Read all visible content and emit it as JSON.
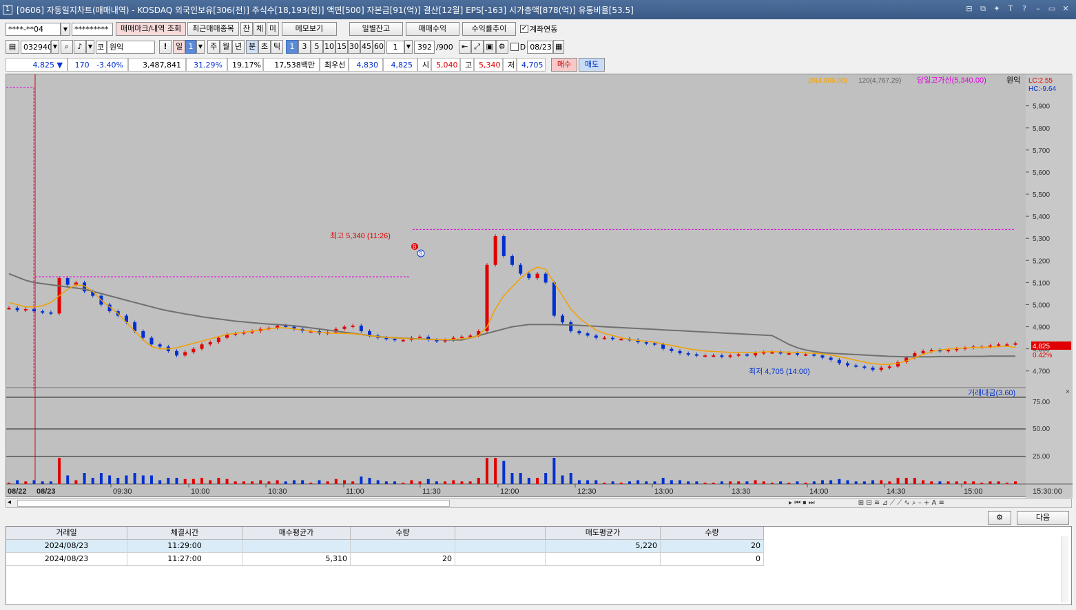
{
  "window": {
    "title": "[0606] 자동일지차트(매매내역) - KOSDAQ 외국인보유[306(천)] 주식수[18,193(천)] 액면[500] 자본금[91(억)] 결산[12월] EPS[-163] 시가총액[878(억)] 유통비율[53.5]",
    "icon_label": "1",
    "buttons": [
      "⊟",
      "⧉",
      "✦",
      "T",
      "?",
      "–",
      "▭",
      "✕"
    ]
  },
  "toolbar1": {
    "account": "****-**04",
    "password": "*********",
    "btn_mark": "매매마크/내역 조회",
    "btn_recent": "최근매매종목",
    "btn_jan": "잔",
    "btn_che": "체",
    "btn_mi": "미",
    "btn_memo": "메모보기",
    "btn_daily": "일별잔고",
    "btn_profit": "매매수익",
    "btn_rate": "수익률추이",
    "chk_label": "계좌연동",
    "chk_mark": "✓"
  },
  "toolbar2": {
    "code": "032940",
    "market": "코",
    "name": "원익",
    "excl": "!",
    "day": "일",
    "day_n": "1",
    "periods": [
      "주",
      "월",
      "년",
      "분",
      "초",
      "틱"
    ],
    "minutes": [
      "1",
      "3",
      "5",
      "10",
      "15",
      "30",
      "45",
      "60"
    ],
    "unit": "1",
    "count": "392",
    "count_max": "/900",
    "d_label": "D",
    "date": "08/23"
  },
  "quote": {
    "price": "4,825",
    "arrow": "▼",
    "change": "170",
    "rate": "-3.40%",
    "volume": "3,487,841",
    "ratio1": "31.29%",
    "ratio2": "19.17%",
    "amount": "17,538백만",
    "best_label": "최우선",
    "best_sell": "4,830",
    "best_buy": "4,825",
    "open_label": "시",
    "open": "5,040",
    "high_label": "고",
    "high": "5,340",
    "low_label": "저",
    "low": "4,705",
    "buy_btn": "매수",
    "sell_btn": "매도"
  },
  "chart_legend": {
    "ma20": "20(4,806.00)",
    "ma120": "120(4,767.29)",
    "high_line": "당일고가선(5,340.00)",
    "stock_name": "원익",
    "lc": "LC:2.55",
    "hc": "HC:-9.64",
    "high_annot": "최고 5,340 (11:26)",
    "low_annot": "최저 4,705 (14:00)",
    "current_price": "4,825",
    "current_rate": "0.42%",
    "buy_marker": "B",
    "sell_marker": "S",
    "volume_legend": "거래대금(3.60)",
    "close_box": "×"
  },
  "colors": {
    "up": "#e00000",
    "down": "#0030d0",
    "ma20": "#f2a000",
    "ma120": "#707070",
    "high_line": "#e000e0",
    "chart_bg": "#c0c0c0"
  },
  "chart_data": {
    "type": "candlestick",
    "price_axis": [
      "5,900",
      "5,800",
      "5,700",
      "5,600",
      "5,500",
      "5,400",
      "5,300",
      "5,200",
      "5,100",
      "5,000",
      "4,900",
      "4,800",
      "4,700"
    ],
    "price_ticks": [
      5900,
      5800,
      5700,
      5600,
      5500,
      5400,
      5300,
      5200,
      5100,
      5000,
      4900,
      4800,
      4700
    ],
    "ylim": [
      4640,
      5980
    ],
    "volume_axis": [
      "75.00",
      "50.00",
      "25.00"
    ],
    "time_axis": [
      "08/22",
      "08/23",
      "09:30",
      "10:00",
      "10:30",
      "11:00",
      "11:30",
      "12:00",
      "12:30",
      "13:00",
      "13:30",
      "14:00",
      "14:30",
      "15:00",
      "15:30:00"
    ],
    "day_high": 5340,
    "day_low": 4705,
    "current": 4825,
    "price_series_close": [
      4985,
      4975,
      4980,
      4970,
      4965,
      4960,
      5120,
      5090,
      5100,
      5060,
      5040,
      5000,
      4970,
      4950,
      4920,
      4880,
      4850,
      4820,
      4810,
      4790,
      4770,
      4785,
      4800,
      4820,
      4830,
      4850,
      4865,
      4870,
      4875,
      4880,
      4890,
      4895,
      4905,
      4900,
      4890,
      4880,
      4880,
      4870,
      4875,
      4890,
      4900,
      4905,
      4880,
      4860,
      4850,
      4845,
      4840,
      4840,
      4850,
      4855,
      4840,
      4835,
      4840,
      4850,
      4855,
      4860,
      4880,
      5180,
      5310,
      5220,
      5180,
      5140,
      5120,
      5140,
      5100,
      4950,
      4920,
      4880,
      4870,
      4860,
      4850,
      4850,
      4845,
      4845,
      4840,
      4830,
      4825,
      4820,
      4800,
      4790,
      4780,
      4775,
      4770,
      4770,
      4770,
      4765,
      4770,
      4775,
      4770,
      4780,
      4785,
      4785,
      4780,
      4780,
      4775,
      4775,
      4770,
      4760,
      4750,
      4735,
      4725,
      4720,
      4715,
      4705,
      4715,
      4720,
      4740,
      4760,
      4780,
      4790,
      4795,
      4790,
      4795,
      4800,
      4805,
      4810,
      4810,
      4815,
      4820,
      4820,
      4825
    ],
    "ma20_series": [
      5010,
      5000,
      4990,
      4990,
      4995,
      5010,
      5040,
      5070,
      5090,
      5085,
      5060,
      5020,
      4990,
      4960,
      4920,
      4880,
      4840,
      4810,
      4800,
      4800,
      4805,
      4815,
      4825,
      4835,
      4845,
      4855,
      4865,
      4870,
      4875,
      4880,
      4885,
      4890,
      4895,
      4895,
      4890,
      4885,
      4880,
      4875,
      4872,
      4870,
      4870,
      4868,
      4865,
      4860,
      4855,
      4852,
      4850,
      4848,
      4845,
      4845,
      4843,
      4842,
      4842,
      4843,
      4845,
      4850,
      4860,
      4900,
      4980,
      5040,
      5080,
      5120,
      5150,
      5170,
      5160,
      5100,
      5040,
      4980,
      4940,
      4910,
      4885,
      4870,
      4860,
      4850,
      4843,
      4838,
      4834,
      4830,
      4822,
      4815,
      4808,
      4800,
      4795,
      4790,
      4788,
      4786,
      4784,
      4783,
      4783,
      4784,
      4786,
      4787,
      4786,
      4785,
      4783,
      4782,
      4780,
      4777,
      4772,
      4765,
      4757,
      4748,
      4740,
      4733,
      4730,
      4730,
      4735,
      4745,
      4760,
      4775,
      4787,
      4795,
      4799,
      4802,
      4804,
      4806,
      4807,
      4808,
      4810,
      4812,
      4806
    ],
    "ma120_series": [
      5140,
      5125,
      5110,
      5100,
      5095,
      5090,
      5085,
      5080,
      5075,
      5070,
      5060,
      5050,
      5040,
      5030,
      5020,
      5010,
      5000,
      4990,
      4980,
      4972,
      4965,
      4958,
      4952,
      4945,
      4940,
      4935,
      4930,
      4925,
      4922,
      4918,
      4915,
      4912,
      4910,
      4907,
      4904,
      4900,
      4895,
      4890,
      4885,
      4880,
      4875,
      4870,
      4865,
      4860,
      4855,
      4852,
      4850,
      4848,
      4846,
      4845,
      4843,
      4842,
      4841,
      4840,
      4840,
      4850,
      4860,
      4870,
      4880,
      4890,
      4900,
      4905,
      4910,
      4910,
      4910,
      4910,
      4909,
      4908,
      4906,
      4904,
      4902,
      4900,
      4898,
      4896,
      4894,
      4892,
      4890,
      4888,
      4886,
      4884,
      4882,
      4880,
      4878,
      4876,
      4874,
      4872,
      4870,
      4868,
      4866,
      4864,
      4862,
      4860,
      4840,
      4820,
      4805,
      4795,
      4788,
      4783,
      4780,
      4778,
      4776,
      4774,
      4772,
      4770,
      4768,
      4766,
      4765,
      4764,
      4764,
      4764,
      4764,
      4765,
      4765,
      4765,
      4766,
      4766,
      4766,
      4767,
      4767,
      4767,
      4767
    ]
  },
  "nav": {
    "left_arrow": "◂",
    "right_arrow": "▸",
    "btn_prev": "⏮",
    "btn_stop": "⏹",
    "btn_next": "⏭",
    "tool_icons": "⊞ ⊟ ≋ ⊿ ⟋ ⟋ ∿ ⌕ – + A ≡"
  },
  "bottom": {
    "gear": "⚙",
    "next_btn": "다음"
  },
  "table": {
    "headers": [
      "거래일",
      "체결시간",
      "매수평균가",
      "수량",
      "",
      "매도평균가",
      "수량"
    ],
    "rows": [
      [
        "2024/08/23",
        "11:29:00",
        "",
        "",
        "",
        "5,220",
        "20"
      ],
      [
        "2024/08/23",
        "11:27:00",
        "5,310",
        "20",
        "",
        "",
        "0"
      ]
    ]
  }
}
